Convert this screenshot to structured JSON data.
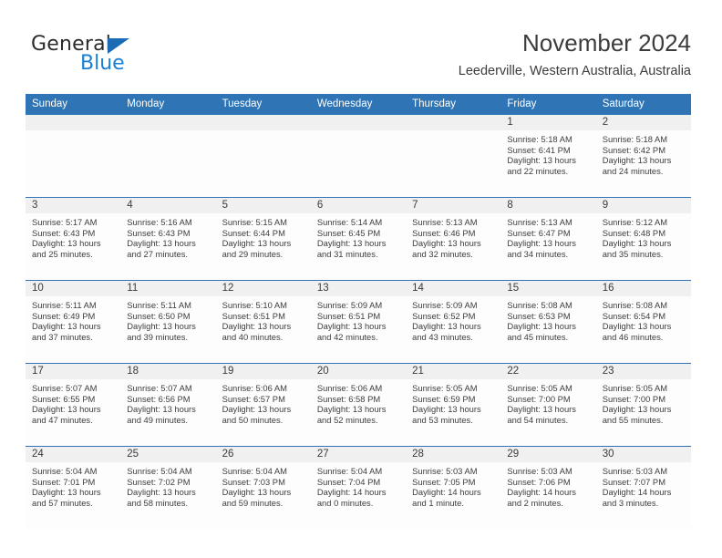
{
  "brand": {
    "name_part1": "General",
    "name_part2": "Blue",
    "flag_color": "#1b6cb5",
    "blue_color": "#1b7fd4"
  },
  "header": {
    "title": "November 2024",
    "subtitle": "Leederville, Western Australia, Australia"
  },
  "theme": {
    "header_blue": "#2f74b5",
    "daynum_band": "#f0f0f0",
    "cell_bg": "#fdfdfd",
    "text": "#3a3a3a"
  },
  "weekdays": [
    "Sunday",
    "Monday",
    "Tuesday",
    "Wednesday",
    "Thursday",
    "Friday",
    "Saturday"
  ],
  "weeks": [
    [
      {
        "day": "",
        "empty": true
      },
      {
        "day": "",
        "empty": true
      },
      {
        "day": "",
        "empty": true
      },
      {
        "day": "",
        "empty": true
      },
      {
        "day": "",
        "empty": true
      },
      {
        "day": "1",
        "sunrise": "Sunrise: 5:18 AM",
        "sunset": "Sunset: 6:41 PM",
        "daylight": "Daylight: 13 hours and 22 minutes."
      },
      {
        "day": "2",
        "sunrise": "Sunrise: 5:18 AM",
        "sunset": "Sunset: 6:42 PM",
        "daylight": "Daylight: 13 hours and 24 minutes."
      }
    ],
    [
      {
        "day": "3",
        "sunrise": "Sunrise: 5:17 AM",
        "sunset": "Sunset: 6:43 PM",
        "daylight": "Daylight: 13 hours and 25 minutes."
      },
      {
        "day": "4",
        "sunrise": "Sunrise: 5:16 AM",
        "sunset": "Sunset: 6:43 PM",
        "daylight": "Daylight: 13 hours and 27 minutes."
      },
      {
        "day": "5",
        "sunrise": "Sunrise: 5:15 AM",
        "sunset": "Sunset: 6:44 PM",
        "daylight": "Daylight: 13 hours and 29 minutes."
      },
      {
        "day": "6",
        "sunrise": "Sunrise: 5:14 AM",
        "sunset": "Sunset: 6:45 PM",
        "daylight": "Daylight: 13 hours and 31 minutes."
      },
      {
        "day": "7",
        "sunrise": "Sunrise: 5:13 AM",
        "sunset": "Sunset: 6:46 PM",
        "daylight": "Daylight: 13 hours and 32 minutes."
      },
      {
        "day": "8",
        "sunrise": "Sunrise: 5:13 AM",
        "sunset": "Sunset: 6:47 PM",
        "daylight": "Daylight: 13 hours and 34 minutes."
      },
      {
        "day": "9",
        "sunrise": "Sunrise: 5:12 AM",
        "sunset": "Sunset: 6:48 PM",
        "daylight": "Daylight: 13 hours and 35 minutes."
      }
    ],
    [
      {
        "day": "10",
        "sunrise": "Sunrise: 5:11 AM",
        "sunset": "Sunset: 6:49 PM",
        "daylight": "Daylight: 13 hours and 37 minutes."
      },
      {
        "day": "11",
        "sunrise": "Sunrise: 5:11 AM",
        "sunset": "Sunset: 6:50 PM",
        "daylight": "Daylight: 13 hours and 39 minutes."
      },
      {
        "day": "12",
        "sunrise": "Sunrise: 5:10 AM",
        "sunset": "Sunset: 6:51 PM",
        "daylight": "Daylight: 13 hours and 40 minutes."
      },
      {
        "day": "13",
        "sunrise": "Sunrise: 5:09 AM",
        "sunset": "Sunset: 6:51 PM",
        "daylight": "Daylight: 13 hours and 42 minutes."
      },
      {
        "day": "14",
        "sunrise": "Sunrise: 5:09 AM",
        "sunset": "Sunset: 6:52 PM",
        "daylight": "Daylight: 13 hours and 43 minutes."
      },
      {
        "day": "15",
        "sunrise": "Sunrise: 5:08 AM",
        "sunset": "Sunset: 6:53 PM",
        "daylight": "Daylight: 13 hours and 45 minutes."
      },
      {
        "day": "16",
        "sunrise": "Sunrise: 5:08 AM",
        "sunset": "Sunset: 6:54 PM",
        "daylight": "Daylight: 13 hours and 46 minutes."
      }
    ],
    [
      {
        "day": "17",
        "sunrise": "Sunrise: 5:07 AM",
        "sunset": "Sunset: 6:55 PM",
        "daylight": "Daylight: 13 hours and 47 minutes."
      },
      {
        "day": "18",
        "sunrise": "Sunrise: 5:07 AM",
        "sunset": "Sunset: 6:56 PM",
        "daylight": "Daylight: 13 hours and 49 minutes."
      },
      {
        "day": "19",
        "sunrise": "Sunrise: 5:06 AM",
        "sunset": "Sunset: 6:57 PM",
        "daylight": "Daylight: 13 hours and 50 minutes."
      },
      {
        "day": "20",
        "sunrise": "Sunrise: 5:06 AM",
        "sunset": "Sunset: 6:58 PM",
        "daylight": "Daylight: 13 hours and 52 minutes."
      },
      {
        "day": "21",
        "sunrise": "Sunrise: 5:05 AM",
        "sunset": "Sunset: 6:59 PM",
        "daylight": "Daylight: 13 hours and 53 minutes."
      },
      {
        "day": "22",
        "sunrise": "Sunrise: 5:05 AM",
        "sunset": "Sunset: 7:00 PM",
        "daylight": "Daylight: 13 hours and 54 minutes."
      },
      {
        "day": "23",
        "sunrise": "Sunrise: 5:05 AM",
        "sunset": "Sunset: 7:00 PM",
        "daylight": "Daylight: 13 hours and 55 minutes."
      }
    ],
    [
      {
        "day": "24",
        "sunrise": "Sunrise: 5:04 AM",
        "sunset": "Sunset: 7:01 PM",
        "daylight": "Daylight: 13 hours and 57 minutes."
      },
      {
        "day": "25",
        "sunrise": "Sunrise: 5:04 AM",
        "sunset": "Sunset: 7:02 PM",
        "daylight": "Daylight: 13 hours and 58 minutes."
      },
      {
        "day": "26",
        "sunrise": "Sunrise: 5:04 AM",
        "sunset": "Sunset: 7:03 PM",
        "daylight": "Daylight: 13 hours and 59 minutes."
      },
      {
        "day": "27",
        "sunrise": "Sunrise: 5:04 AM",
        "sunset": "Sunset: 7:04 PM",
        "daylight": "Daylight: 14 hours and 0 minutes."
      },
      {
        "day": "28",
        "sunrise": "Sunrise: 5:03 AM",
        "sunset": "Sunset: 7:05 PM",
        "daylight": "Daylight: 14 hours and 1 minute."
      },
      {
        "day": "29",
        "sunrise": "Sunrise: 5:03 AM",
        "sunset": "Sunset: 7:06 PM",
        "daylight": "Daylight: 14 hours and 2 minutes."
      },
      {
        "day": "30",
        "sunrise": "Sunrise: 5:03 AM",
        "sunset": "Sunset: 7:07 PM",
        "daylight": "Daylight: 14 hours and 3 minutes."
      }
    ]
  ]
}
